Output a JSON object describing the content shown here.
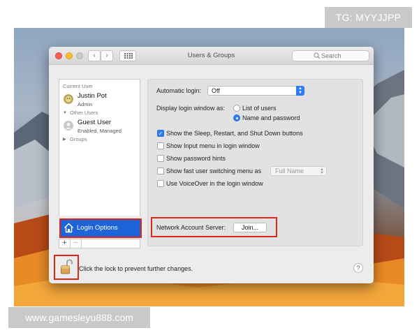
{
  "watermarks": {
    "top": "TG: MYYJJPP",
    "bottom": "www.gamesleyu888.com"
  },
  "window": {
    "title": "Users & Groups",
    "search_placeholder": "Search",
    "nav_back": "‹",
    "nav_fwd": "›"
  },
  "sidebar": {
    "current_user_label": "Current User",
    "current_user": {
      "name": "Justin Pot",
      "role": "Admin"
    },
    "other_users_label": "Other Users",
    "other_users": [
      {
        "name": "Guest User",
        "role": "Enabled, Managed"
      }
    ],
    "groups_label": "Groups",
    "login_options_label": "Login Options",
    "add_label": "+",
    "remove_label": "−"
  },
  "panel": {
    "automatic_login_label": "Automatic login:",
    "automatic_login_value": "Off",
    "display_login_label": "Display login window as:",
    "display_options": [
      {
        "label": "List of users",
        "selected": false
      },
      {
        "label": "Name and password",
        "selected": true
      }
    ],
    "checkboxes": [
      {
        "label": "Show the Sleep, Restart, and Shut Down buttons",
        "checked": true
      },
      {
        "label": "Show Input menu in login window",
        "checked": false
      },
      {
        "label": "Show password hints",
        "checked": false
      },
      {
        "label": "Show fast user switching menu as",
        "checked": false
      },
      {
        "label": "Use VoiceOver in the login window",
        "checked": false
      }
    ],
    "fast_user_switching_value": "Full Name",
    "network_server_label": "Network Account Server:",
    "join_label": "Join..."
  },
  "footer": {
    "lock_text": "Click the lock to prevent further changes.",
    "help_label": "?"
  },
  "colors": {
    "accent": "#2d7cf6",
    "selection": "#1d64d8",
    "highlight_outline": "#e0251b"
  },
  "icons": {
    "lock": "lock-open-icon",
    "home": "house-icon",
    "search": "search-icon"
  }
}
